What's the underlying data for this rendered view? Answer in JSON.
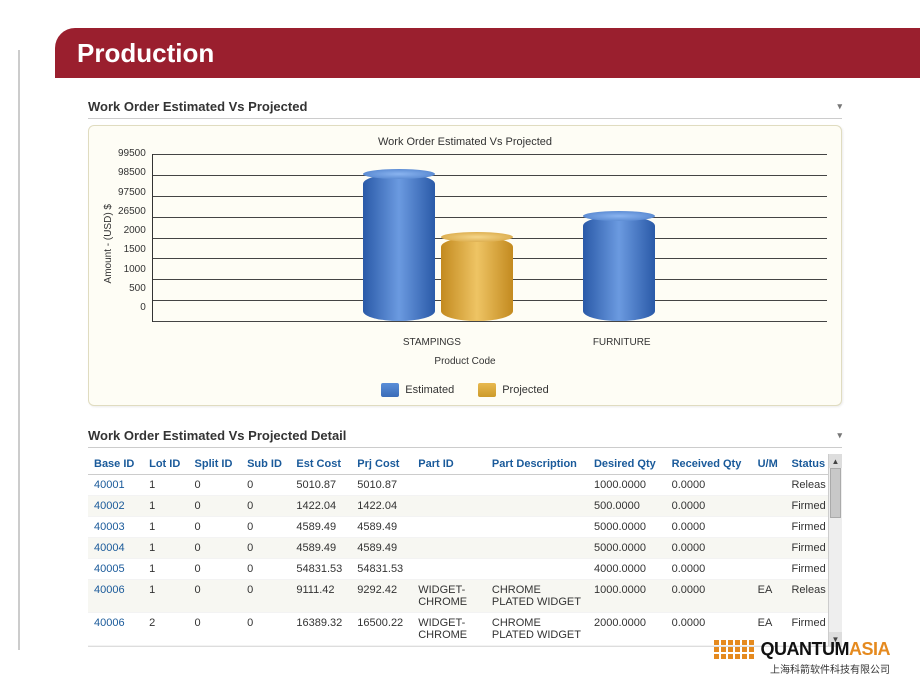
{
  "header": {
    "title": "Production"
  },
  "chart_section": {
    "title": "Work Order Estimated Vs Projected"
  },
  "chart_data": {
    "type": "bar",
    "title": "Work Order Estimated Vs Projected",
    "xlabel": "Product Code",
    "ylabel": "Amount - (USD) $",
    "categories": [
      "STAMPINGS",
      "FURNITURE"
    ],
    "y_ticks": [
      99500,
      98500,
      97500,
      26500,
      2000,
      1500,
      1000,
      500,
      0
    ],
    "series": [
      {
        "name": "Estimated",
        "values": [
          98500,
          26500
        ]
      },
      {
        "name": "Projected",
        "values": [
          2100,
          null
        ]
      }
    ],
    "legend": [
      "Estimated",
      "Projected"
    ]
  },
  "detail_section": {
    "title": "Work Order Estimated Vs Projected Detail",
    "columns": [
      "Base ID",
      "Lot ID",
      "Split ID",
      "Sub ID",
      "Est Cost",
      "Prj Cost",
      "Part ID",
      "Part Description",
      "Desired Qty",
      "Received Qty",
      "U/M",
      "Status"
    ],
    "rows": [
      {
        "base_id": "40001",
        "lot": "1",
        "split": "0",
        "sub": "0",
        "est": "5010.87",
        "prj": "5010.87",
        "part": "",
        "desc": "",
        "dq": "1000.0000",
        "rq": "0.0000",
        "um": "",
        "status": "Releas"
      },
      {
        "base_id": "40002",
        "lot": "1",
        "split": "0",
        "sub": "0",
        "est": "1422.04",
        "prj": "1422.04",
        "part": "",
        "desc": "",
        "dq": "500.0000",
        "rq": "0.0000",
        "um": "",
        "status": "Firmed"
      },
      {
        "base_id": "40003",
        "lot": "1",
        "split": "0",
        "sub": "0",
        "est": "4589.49",
        "prj": "4589.49",
        "part": "",
        "desc": "",
        "dq": "5000.0000",
        "rq": "0.0000",
        "um": "",
        "status": "Firmed"
      },
      {
        "base_id": "40004",
        "lot": "1",
        "split": "0",
        "sub": "0",
        "est": "4589.49",
        "prj": "4589.49",
        "part": "",
        "desc": "",
        "dq": "5000.0000",
        "rq": "0.0000",
        "um": "",
        "status": "Firmed"
      },
      {
        "base_id": "40005",
        "lot": "1",
        "split": "0",
        "sub": "0",
        "est": "54831.53",
        "prj": "54831.53",
        "part": "",
        "desc": "",
        "dq": "4000.0000",
        "rq": "0.0000",
        "um": "",
        "status": "Firmed"
      },
      {
        "base_id": "40006",
        "lot": "1",
        "split": "0",
        "sub": "0",
        "est": "9111.42",
        "prj": "9292.42",
        "part": "WIDGET-CHROME",
        "desc": "CHROME PLATED WIDGET",
        "dq": "1000.0000",
        "rq": "0.0000",
        "um": "EA",
        "status": "Releas"
      },
      {
        "base_id": "40006",
        "lot": "2",
        "split": "0",
        "sub": "0",
        "est": "16389.32",
        "prj": "16500.22",
        "part": "WIDGET-CHROME",
        "desc": "CHROME PLATED WIDGET",
        "dq": "2000.0000",
        "rq": "0.0000",
        "um": "EA",
        "status": "Firmed"
      }
    ]
  },
  "footer": {
    "brand1": "QUANTUM",
    "brand2": "ASIA",
    "sub": "上海科箭软件科技有限公司"
  }
}
